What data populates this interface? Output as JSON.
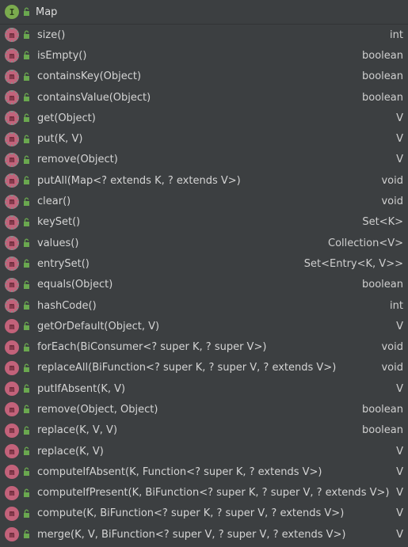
{
  "header": {
    "title": "Map",
    "icon": "interface-icon",
    "badge_letter": "I"
  },
  "badge_letter": "m",
  "accent_colors": {
    "method": "#c2627a",
    "interface": "#7bab4e",
    "lock": "#6aa84f"
  },
  "members": [
    {
      "name": "size()",
      "type": "int",
      "abstract": true
    },
    {
      "name": "isEmpty()",
      "type": "boolean",
      "abstract": true
    },
    {
      "name": "containsKey(Object)",
      "type": "boolean",
      "abstract": true
    },
    {
      "name": "containsValue(Object)",
      "type": "boolean",
      "abstract": true
    },
    {
      "name": "get(Object)",
      "type": "V",
      "abstract": true
    },
    {
      "name": "put(K, V)",
      "type": "V",
      "abstract": true
    },
    {
      "name": "remove(Object)",
      "type": "V",
      "abstract": true
    },
    {
      "name": "putAll(Map<? extends K, ? extends V>)",
      "type": "void",
      "abstract": true
    },
    {
      "name": "clear()",
      "type": "void",
      "abstract": true
    },
    {
      "name": "keySet()",
      "type": "Set<K>",
      "abstract": true
    },
    {
      "name": "values()",
      "type": "Collection<V>",
      "abstract": true
    },
    {
      "name": "entrySet()",
      "type": "Set<Entry<K, V>>",
      "abstract": true
    },
    {
      "name": "equals(Object)",
      "type": "boolean",
      "abstract": true
    },
    {
      "name": "hashCode()",
      "type": "int",
      "abstract": true
    },
    {
      "name": "getOrDefault(Object, V)",
      "type": "V",
      "abstract": false
    },
    {
      "name": "forEach(BiConsumer<? super K, ? super V>)",
      "type": "void",
      "abstract": false
    },
    {
      "name": "replaceAll(BiFunction<? super K, ? super V, ? extends V>)",
      "type": "void",
      "abstract": false
    },
    {
      "name": "putIfAbsent(K, V)",
      "type": "V",
      "abstract": false
    },
    {
      "name": "remove(Object, Object)",
      "type": "boolean",
      "abstract": false
    },
    {
      "name": "replace(K, V, V)",
      "type": "boolean",
      "abstract": false
    },
    {
      "name": "replace(K, V)",
      "type": "V",
      "abstract": false
    },
    {
      "name": "computeIfAbsent(K, Function<? super K, ? extends V>)",
      "type": "V",
      "abstract": false
    },
    {
      "name": "computeIfPresent(K, BiFunction<? super K, ? super V, ? extends V>)",
      "type": "V",
      "abstract": false
    },
    {
      "name": "compute(K, BiFunction<? super K, ? super V, ? extends V>)",
      "type": "V",
      "abstract": false
    },
    {
      "name": "merge(K, V, BiFunction<? super V, ? super V, ? extends V>)",
      "type": "V",
      "abstract": false
    }
  ]
}
